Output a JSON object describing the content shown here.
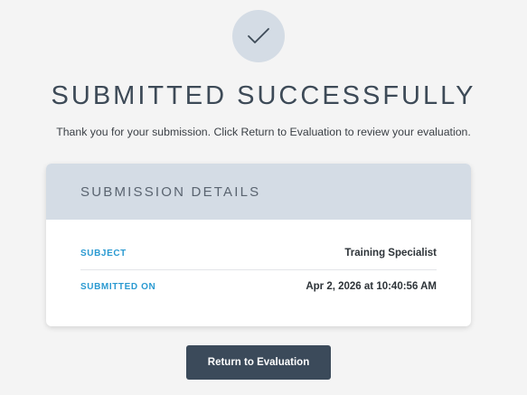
{
  "status": {
    "icon": "checkmark-icon",
    "headline": "SUBMITTED SUCCESSFULLY",
    "message": "Thank you for your submission. Click Return to Evaluation to review your evaluation."
  },
  "details": {
    "title": "SUBMISSION DETAILS",
    "rows": [
      {
        "label": "SUBJECT",
        "value": "Training Specialist"
      },
      {
        "label": "SUBMITTED ON",
        "value": "Apr 2, 2026 at 10:40:56 AM"
      }
    ]
  },
  "actions": {
    "return_label": "Return to Evaluation"
  },
  "colors": {
    "page_background": "#f4f4f4",
    "accent_light": "#d4dce5",
    "label_blue": "#2b9ad1",
    "button_dark": "#3b4a5a"
  }
}
